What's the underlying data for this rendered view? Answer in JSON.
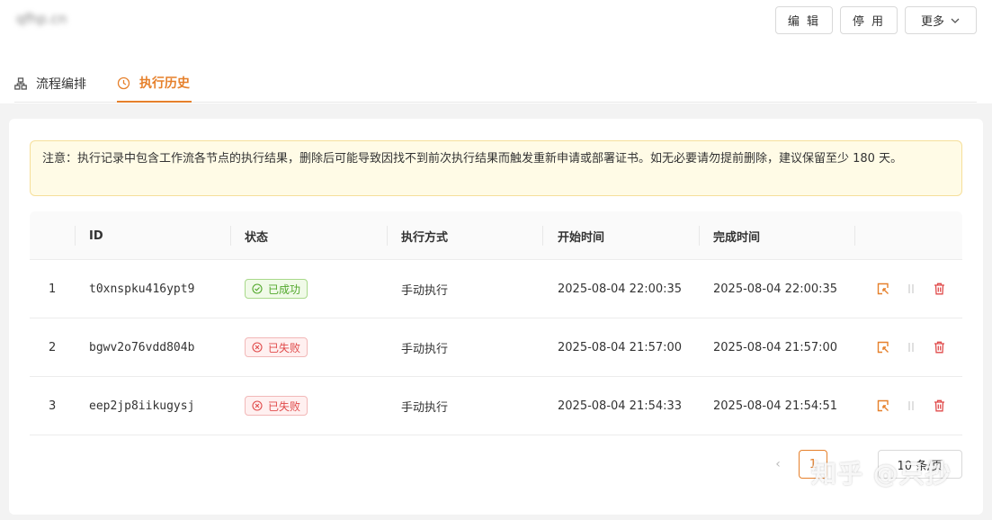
{
  "header": {
    "blurred_title": "qfhp.cn",
    "edit_label": "编 辑",
    "disable_label": "停 用",
    "more_label": "更多"
  },
  "tabs": [
    {
      "label": "流程编排",
      "icon": "flow-icon",
      "active": false
    },
    {
      "label": "执行历史",
      "icon": "history-icon",
      "active": true
    }
  ],
  "notice": "注意：执行记录中包含工作流各节点的执行结果，删除后可能导致因找不到前次执行结果而触发重新申请或部署证书。如无必要请勿提前删除，建议保留至少 180 天。",
  "table": {
    "columns": [
      "ID",
      "状态",
      "执行方式",
      "开始时间",
      "完成时间"
    ],
    "rows": [
      {
        "index": "1",
        "id": "t0xnspku416ypt9",
        "status": "已成功",
        "status_type": "success",
        "mode": "手动执行",
        "start": "2025-08-04 22:00:35",
        "end": "2025-08-04 22:00:35"
      },
      {
        "index": "2",
        "id": "bgwv2o76vdd804b",
        "status": "已失败",
        "status_type": "fail",
        "mode": "手动执行",
        "start": "2025-08-04 21:57:00",
        "end": "2025-08-04 21:57:00"
      },
      {
        "index": "3",
        "id": "eep2jp8iikugysj",
        "status": "已失败",
        "status_type": "fail",
        "mode": "手动执行",
        "start": "2025-08-04 21:54:33",
        "end": "2025-08-04 21:54:51"
      }
    ]
  },
  "pagination": {
    "prev": "‹",
    "page": "1",
    "page_size": "10 条/页"
  },
  "watermark": "知乎 @只抄",
  "colors": {
    "accent": "#e6802b",
    "success": "#52a82c",
    "danger": "#e04b4b"
  }
}
